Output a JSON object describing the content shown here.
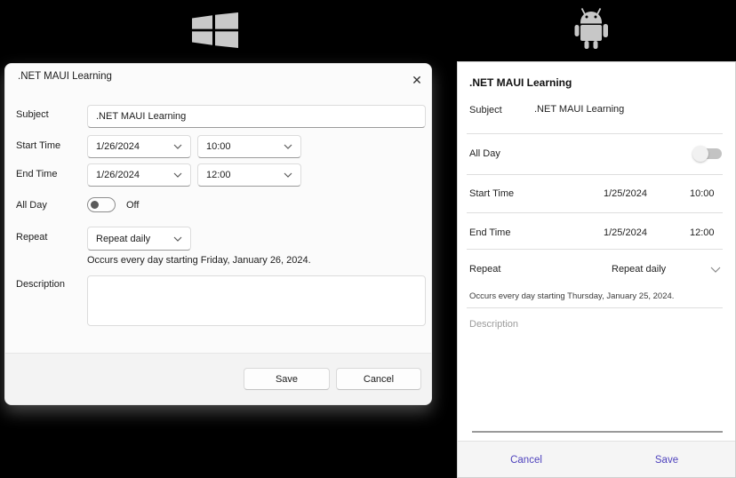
{
  "windows": {
    "dialog": {
      "title": ".NET MAUI Learning",
      "close_icon": "✕",
      "fields": {
        "subject": {
          "label": "Subject",
          "value": ".NET MAUI Learning"
        },
        "start": {
          "label": "Start Time",
          "date": "1/26/2024",
          "time": "10:00"
        },
        "end": {
          "label": "End Time",
          "date": "1/26/2024",
          "time": "12:00"
        },
        "all_day": {
          "label": "All Day",
          "state": "Off"
        },
        "repeat": {
          "label": "Repeat",
          "value": "Repeat daily"
        },
        "occurs": "Occurs every day starting Friday, January 26, 2024.",
        "description": {
          "label": "Description",
          "value": ""
        }
      },
      "buttons": {
        "save": "Save",
        "cancel": "Cancel"
      }
    }
  },
  "android": {
    "title": ".NET MAUI Learning",
    "fields": {
      "subject": {
        "label": "Subject",
        "value": ".NET MAUI Learning"
      },
      "all_day": {
        "label": "All Day"
      },
      "start": {
        "label": "Start Time",
        "date": "1/25/2024",
        "time": "10:00"
      },
      "end": {
        "label": "End Time",
        "date": "1/25/2024",
        "time": "12:00"
      },
      "repeat": {
        "label": "Repeat",
        "value": "Repeat daily"
      },
      "occurs": "Occurs every day starting Thursday, January 25, 2024.",
      "description_placeholder": "Description"
    },
    "buttons": {
      "cancel": "Cancel",
      "save": "Save"
    },
    "accent_color": "#4f43bd"
  }
}
